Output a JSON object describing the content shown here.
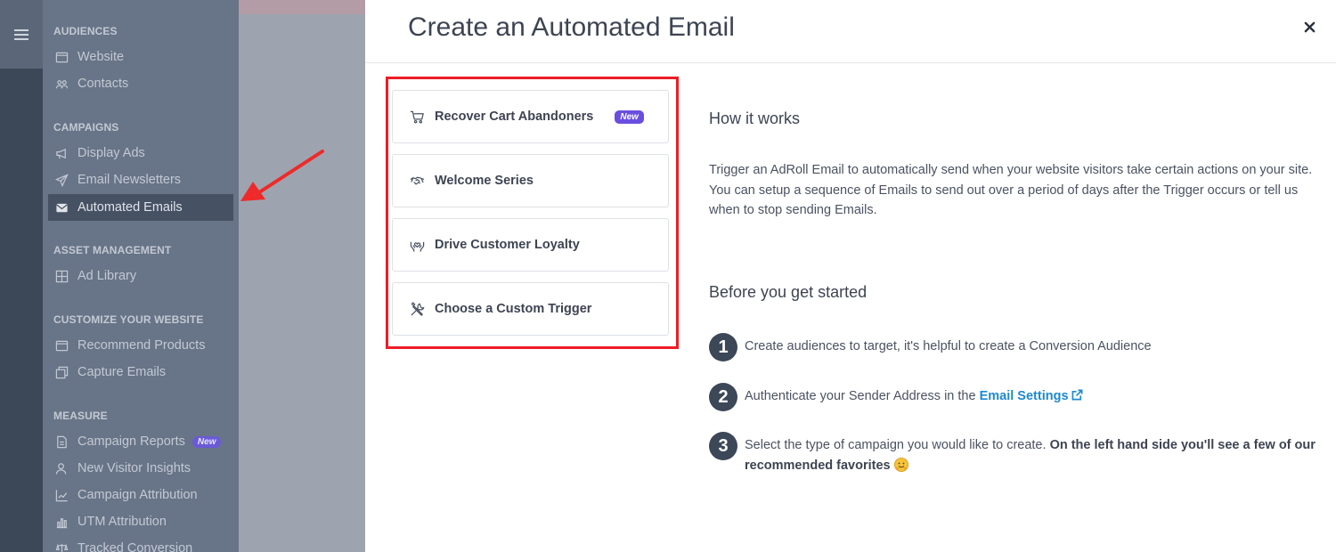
{
  "sidebar": {
    "sections": [
      {
        "title": "AUDIENCES",
        "items": [
          {
            "label": "Website",
            "icon": "browser-icon"
          },
          {
            "label": "Contacts",
            "icon": "people-icon"
          }
        ]
      },
      {
        "title": "CAMPAIGNS",
        "items": [
          {
            "label": "Display Ads",
            "icon": "megaphone-icon"
          },
          {
            "label": "Email Newsletters",
            "icon": "paper-plane-icon"
          },
          {
            "label": "Automated Emails",
            "icon": "envelope-icon",
            "active": true
          }
        ]
      },
      {
        "title": "ASSET MANAGEMENT",
        "items": [
          {
            "label": "Ad Library",
            "icon": "grid-icon"
          }
        ]
      },
      {
        "title": "CUSTOMIZE YOUR WEBSITE",
        "items": [
          {
            "label": "Recommend Products",
            "icon": "browser-icon"
          },
          {
            "label": "Capture Emails",
            "icon": "popup-icon"
          }
        ]
      },
      {
        "title": "MEASURE",
        "items": [
          {
            "label": "Campaign Reports",
            "icon": "report-icon",
            "badge": "New"
          },
          {
            "label": "New Visitor Insights",
            "icon": "user-icon"
          },
          {
            "label": "Campaign Attribution",
            "icon": "line-chart-icon"
          },
          {
            "label": "UTM Attribution",
            "icon": "bar-chart-icon"
          },
          {
            "label": "Tracked Conversion",
            "icon": "scale-icon"
          }
        ]
      }
    ]
  },
  "modal": {
    "title": "Create an Automated Email",
    "close_label": "×",
    "triggers": [
      {
        "label": "Recover Cart Abandoners",
        "icon": "cart-icon",
        "badge": "New"
      },
      {
        "label": "Welcome Series",
        "icon": "handshake-icon"
      },
      {
        "label": "Drive Customer Loyalty",
        "icon": "hands-heart-icon"
      },
      {
        "label": "Choose a Custom Trigger",
        "icon": "tools-icon"
      }
    ],
    "how_it_works": {
      "heading": "How it works",
      "body": "Trigger an AdRoll Email to automatically send when your website visitors take certain actions on your site. You can setup a sequence of Emails to send out over a period of days after the Trigger occurs or tell us when to stop sending Emails."
    },
    "before_you_start": {
      "heading": "Before you get started",
      "steps": [
        {
          "num": "1",
          "text": "Create audiences to target, it's helpful to create a Conversion Audience"
        },
        {
          "num": "2",
          "text": "Authenticate your Sender Address in the ",
          "link": "Email Settings"
        },
        {
          "num": "3",
          "text": "Select the type of campaign you would like to create. ",
          "bold": "On the left hand side you'll see a few of our recommended favorites"
        }
      ]
    }
  },
  "colors": {
    "highlight": "#ee1c24",
    "badge": "#6a4ee0",
    "link": "#1c8ad1",
    "annotation_arrow": "#ee2a2a"
  }
}
